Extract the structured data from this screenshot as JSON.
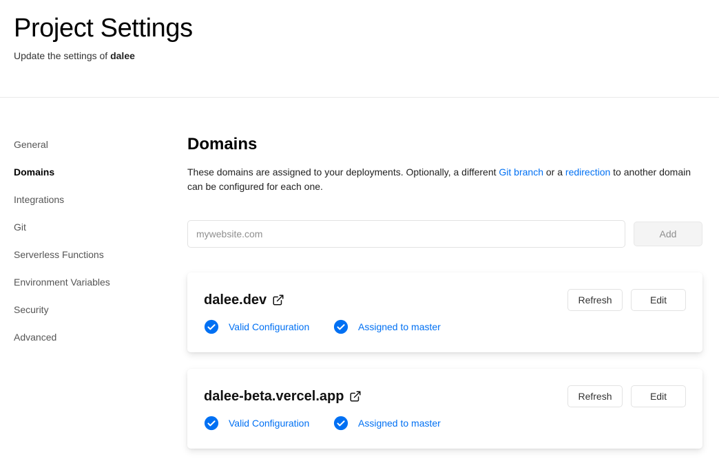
{
  "header": {
    "title": "Project Settings",
    "subtitle_prefix": "Update the settings of",
    "project_name": "dalee"
  },
  "sidebar": {
    "items": [
      {
        "label": "General"
      },
      {
        "label": "Domains"
      },
      {
        "label": "Integrations"
      },
      {
        "label": "Git"
      },
      {
        "label": "Serverless Functions"
      },
      {
        "label": "Environment Variables"
      },
      {
        "label": "Security"
      },
      {
        "label": "Advanced"
      }
    ],
    "active": "Domains"
  },
  "main": {
    "title": "Domains",
    "desc_part1": "These domains are assigned to your deployments. Optionally, a different ",
    "desc_link1": "Git branch",
    "desc_part2": " or a ",
    "desc_link2": "redirection",
    "desc_part3": " to another domain can be configured for each one.",
    "input_placeholder": "mywebsite.com",
    "input_value": "",
    "add_label": "Add"
  },
  "domains": [
    {
      "name": "dalee.dev",
      "refresh_label": "Refresh",
      "edit_label": "Edit",
      "status_config": "Valid Configuration",
      "status_assigned": "Assigned to master"
    },
    {
      "name": "dalee-beta.vercel.app",
      "refresh_label": "Refresh",
      "edit_label": "Edit",
      "status_config": "Valid Configuration",
      "status_assigned": "Assigned to master"
    }
  ],
  "colors": {
    "accent": "#0070f3",
    "border": "#eaeaea",
    "muted_text": "#555555"
  },
  "icons": {
    "external_link": "external-link-icon",
    "check": "check-circle-icon"
  }
}
